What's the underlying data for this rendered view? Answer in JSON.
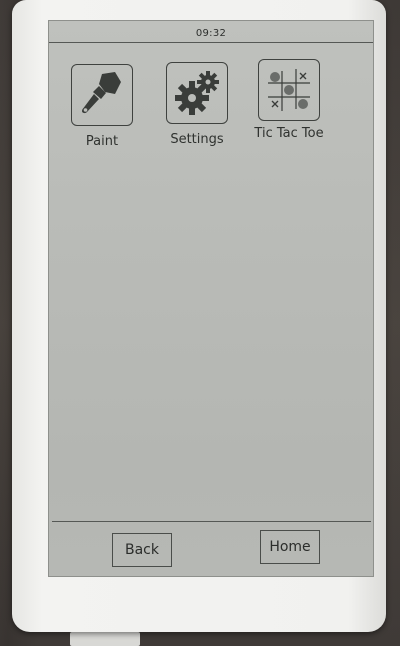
{
  "status_bar": {
    "time": "09:32"
  },
  "apps": [
    {
      "label": "Paint",
      "icon": "paintbrush-icon"
    },
    {
      "label": "Settings",
      "icon": "gears-icon"
    },
    {
      "label": "Tic Tac Toe",
      "icon": "tic-tac-toe-icon"
    }
  ],
  "nav": {
    "back_label": "Back",
    "home_label": "Home"
  },
  "colors": {
    "screen": "#bbbdb9",
    "ink": "#3f423f",
    "bezel": "#f1f1ef"
  }
}
